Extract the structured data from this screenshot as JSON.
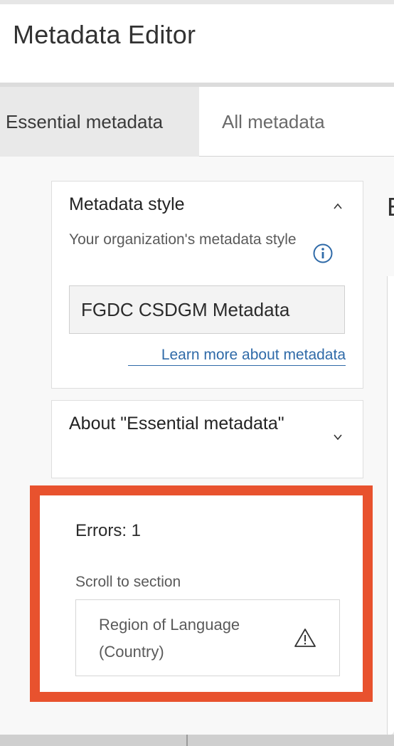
{
  "window": {
    "title": "Metadata Editor"
  },
  "tabs": [
    {
      "label": "Essential metadata",
      "active": true
    },
    {
      "label": "All metadata",
      "active": false
    }
  ],
  "style_card": {
    "title": "Metadata style",
    "expanded": true,
    "field_label": "Your organization's metadata style",
    "value": "FGDC CSDGM Metadata",
    "link": "Learn more about metadata"
  },
  "about_card": {
    "title": "About \"Essential metadata\"",
    "expanded": false
  },
  "errors": {
    "title": "Errors: 1",
    "scroll_label": "Scroll to section",
    "items": [
      {
        "text": "Region of Language (Country)",
        "icon": "warning-icon"
      }
    ]
  },
  "right_header_partial": "E",
  "colors": {
    "highlight": "#e8522e",
    "link": "#2f6aa8",
    "info": "#2f6aa8"
  }
}
